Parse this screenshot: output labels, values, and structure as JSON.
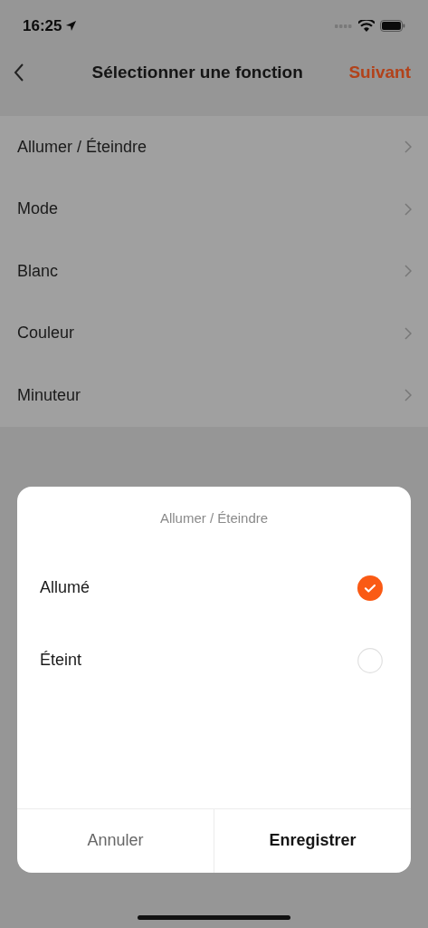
{
  "status_bar": {
    "time": "16:25"
  },
  "header": {
    "title": "Sélectionner une fonction",
    "action": "Suivant"
  },
  "functions": [
    {
      "label": "Allumer / Éteindre"
    },
    {
      "label": "Mode"
    },
    {
      "label": "Blanc"
    },
    {
      "label": "Couleur"
    },
    {
      "label": "Minuteur"
    }
  ],
  "sheet": {
    "title": "Allumer / Éteindre",
    "options": [
      {
        "label": "Allumé",
        "selected": true
      },
      {
        "label": "Éteint",
        "selected": false
      }
    ],
    "cancel": "Annuler",
    "save": "Enregistrer"
  }
}
